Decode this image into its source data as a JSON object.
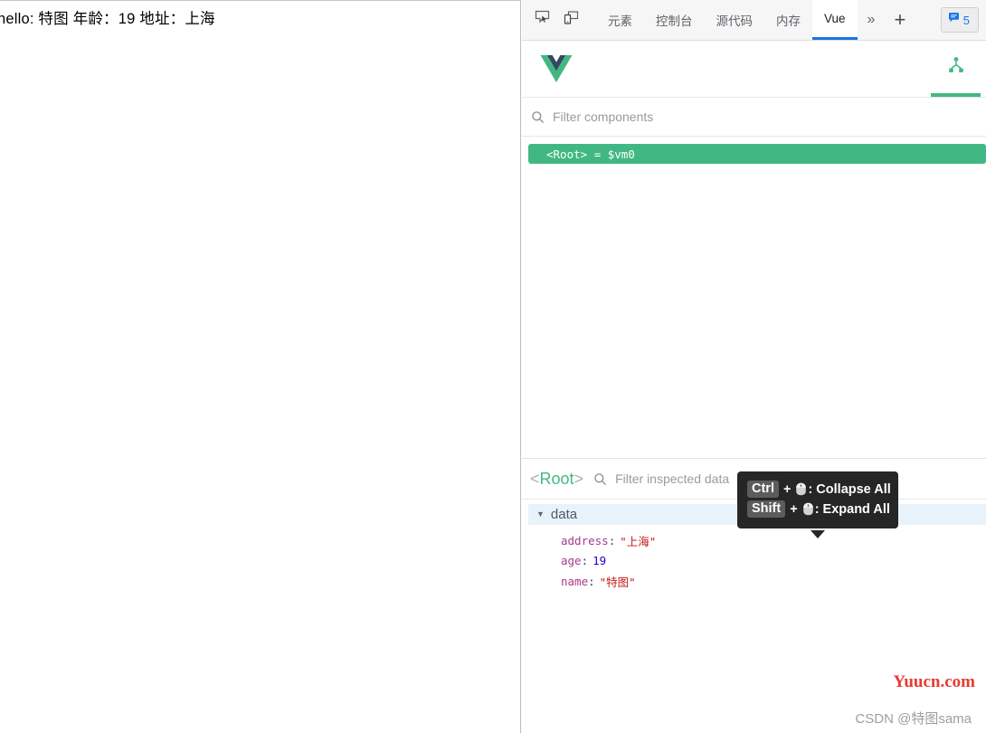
{
  "page": {
    "content_text": "hello: 特图 年龄：19 地址：上海"
  },
  "devtools": {
    "toolbar": {
      "inspect_icon": "inspect-element-icon",
      "device_icon": "device-toolbar-icon",
      "tabs": [
        {
          "label": "元素",
          "active": false
        },
        {
          "label": "控制台",
          "active": false
        },
        {
          "label": "源代码",
          "active": false
        },
        {
          "label": "内存",
          "active": false
        },
        {
          "label": "Vue",
          "active": true
        }
      ],
      "more_label": "»",
      "add_label": "+",
      "message_badge": {
        "icon": "message-bubble-icon",
        "count": "5"
      },
      "accent_color": "#1a73e8"
    },
    "vue_panel": {
      "logo": "vue-logo-icon",
      "panel_tabs": [
        {
          "icon": "component-tree-icon",
          "active": true
        }
      ],
      "accent_color": "#42b883",
      "filter": {
        "placeholder": "Filter components",
        "value": "",
        "icon": "search-icon"
      },
      "tree": {
        "rows": [
          {
            "tag": "<Root>",
            "equals": "=",
            "instance": "$vm0",
            "selected": true
          }
        ]
      }
    },
    "inspector": {
      "breadcrumb_open": "<",
      "breadcrumb_name": "Root",
      "breadcrumb_close": ">",
      "filter": {
        "placeholder": "Filter inspected data",
        "value": "",
        "icon": "search-icon"
      },
      "tooltip": {
        "rows": [
          {
            "key": "Ctrl",
            "plus": "+",
            "mouse": "mouse-icon",
            "action": ": Collapse All"
          },
          {
            "key": "Shift",
            "plus": "+",
            "mouse": "mouse-icon",
            "action": ": Expand All"
          }
        ]
      },
      "groups": [
        {
          "name": "data",
          "expanded": true,
          "caret": "▼",
          "entries": [
            {
              "key": "address",
              "value": "\"上海\"",
              "type": "string"
            },
            {
              "key": "age",
              "value": "19",
              "type": "number"
            },
            {
              "key": "name",
              "value": "\"特图\"",
              "type": "string"
            }
          ]
        }
      ]
    }
  },
  "watermarks": {
    "primary": "Yuucn.com",
    "secondary": "CSDN @特图sama"
  }
}
